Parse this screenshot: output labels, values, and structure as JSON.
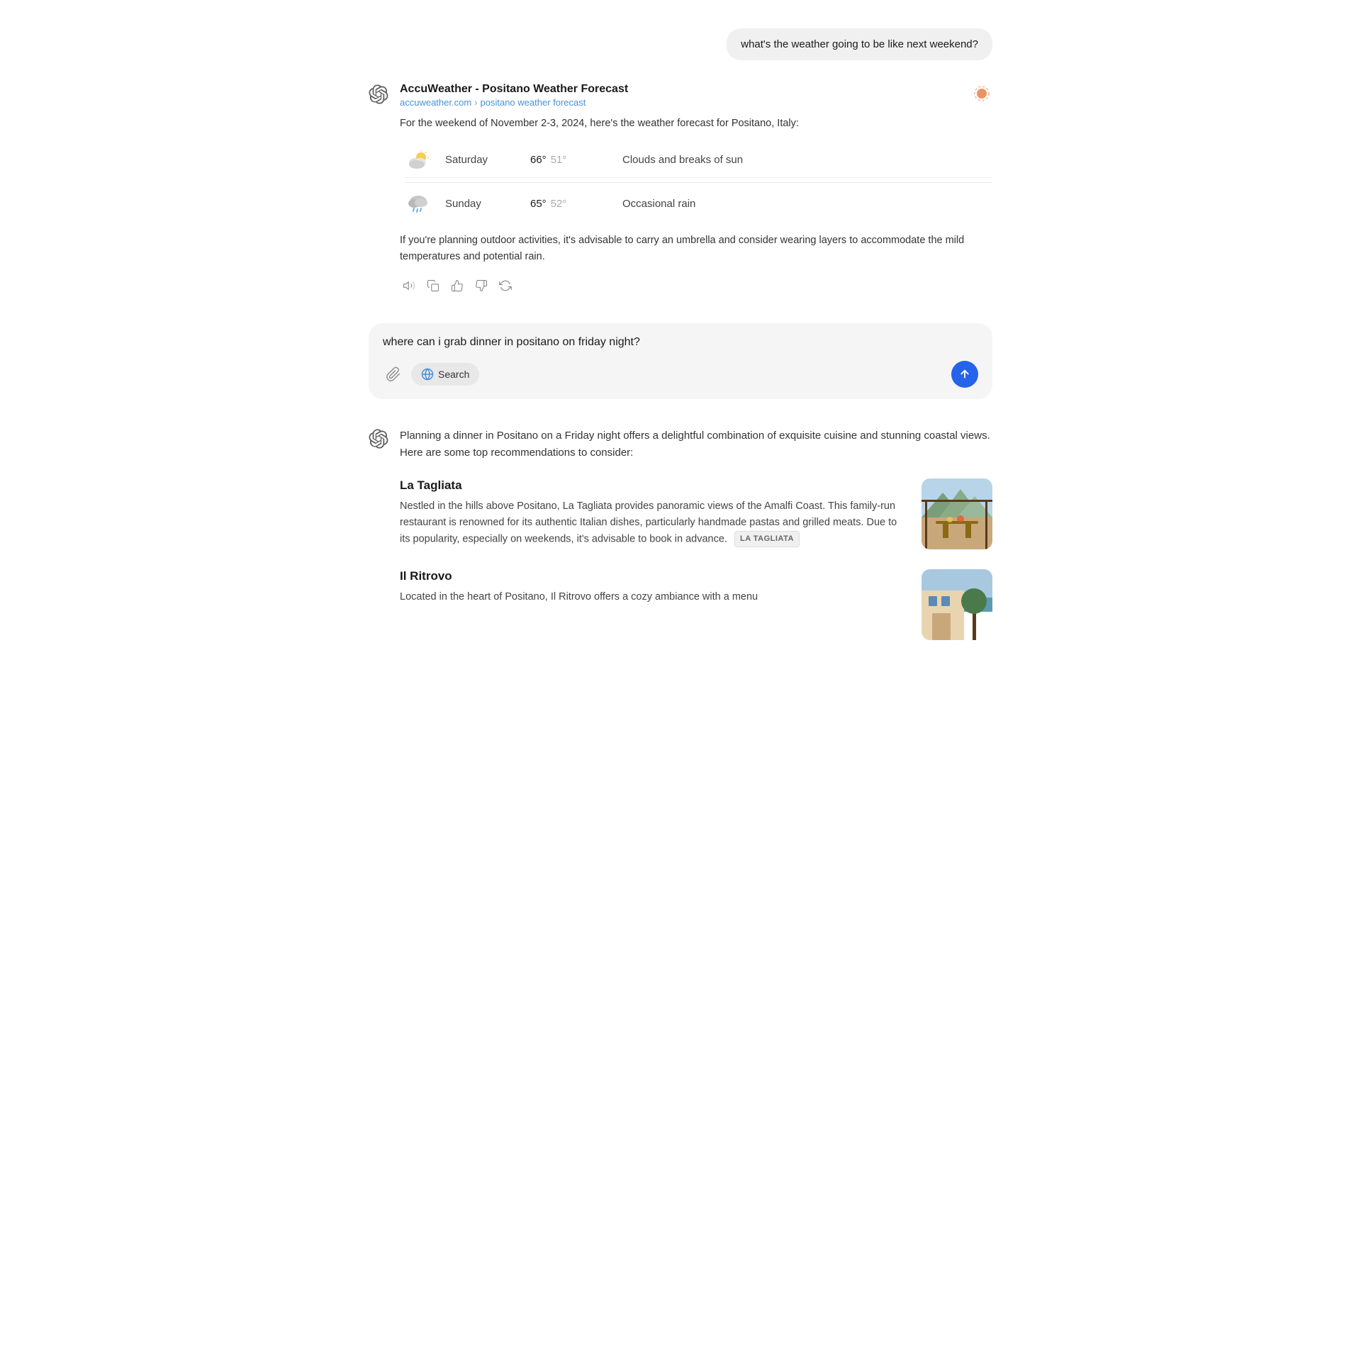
{
  "userMessage1": {
    "text": "what's the weather going to be like next weekend?"
  },
  "weatherResponse": {
    "sourceTitle": "AccuWeather - Positano Weather Forecast",
    "sourceUrl": "accuweather.com",
    "sourcePath": "positano weather forecast",
    "intro": "For the weekend of November 2-3, 2024, here's the weather forecast for Positano, Italy:",
    "days": [
      {
        "day": "Saturday",
        "tempHigh": "66°",
        "tempLow": "51°",
        "description": "Clouds and breaks of sun",
        "icon": "partly-cloudy"
      },
      {
        "day": "Sunday",
        "tempHigh": "65°",
        "tempLow": "52°",
        "description": "Occasional rain",
        "icon": "rain"
      }
    ],
    "advice": "If you're planning outdoor activities, it's advisable to carry an umbrella and consider wearing layers to accommodate the mild temperatures and potential rain."
  },
  "userMessage2": {
    "text": "where can i grab dinner in positano on friday night?"
  },
  "inputArea": {
    "text": "where can i grab dinner in positano on friday night?",
    "searchLabel": "Search",
    "attachTooltip": "Attach file"
  },
  "restaurantResponse": {
    "intro": "Planning a dinner in Positano on a Friday night offers a delightful combination of exquisite cuisine and stunning coastal views. Here are some top recommendations to consider:",
    "restaurants": [
      {
        "name": "La Tagliata",
        "description": "Nestled in the hills above Positano, La Tagliata provides panoramic views of the Amalfi Coast. This family-run restaurant is renowned for its authentic Italian dishes, particularly handmade pastas and grilled meats. Due to its popularity, especially on weekends, it's advisable to book in advance.",
        "tag": "LA TAGLIATA",
        "imageAlt": "La Tagliata restaurant with mountain view and outdoor seating",
        "imageBg": "#8aaa88"
      },
      {
        "name": "Il Ritrovo",
        "description": "Located in the heart of Positano, Il Ritrovo offers a cozy ambiance with a menu",
        "tag": "",
        "imageAlt": "Il Ritrovo restaurant view",
        "imageBg": "#6a8a6a"
      }
    ]
  },
  "icons": {
    "sunColor": "#e8834a",
    "globeColor": "#4a90d9",
    "sendColor": "#2563eb"
  }
}
